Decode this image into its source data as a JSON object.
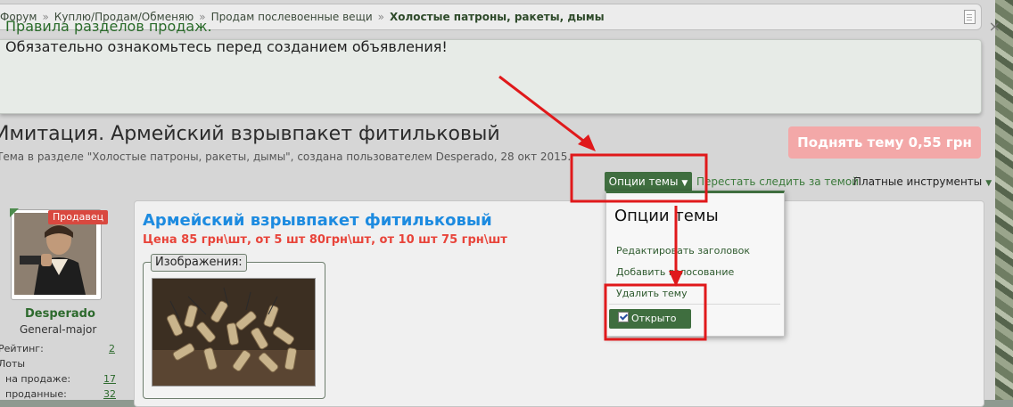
{
  "breadcrumb": {
    "items": [
      "Форум",
      "Куплю/Продам/Обменяю",
      "Продам послевоенные вещи"
    ],
    "current": "Холостые патроны, ракеты, дымы",
    "separator": "»"
  },
  "notice": {
    "title": "Правила разделов продаж.",
    "text": "Обязательно ознакомьтесь перед созданием объявления!",
    "close": "×"
  },
  "thread": {
    "title": "Имитация. Армейский взрывпакет фитильковый",
    "meta": "Тема в разделе \"Холостые патроны, ракеты, дымы\", создана пользователем Desperado, 28 окт 2015.",
    "bump_button": "Поднять тему 0,55 грн"
  },
  "toolbar": {
    "options_label": "Опции темы",
    "unwatch_label": "Перестать следить за темой",
    "paid_tools_label": "Платные инструменты"
  },
  "menu": {
    "title": "Опции темы",
    "items": [
      "Редактировать заголовок",
      "Добавить голосование",
      "Удалить тему"
    ],
    "open_label": "Открыто",
    "open_checked": true
  },
  "post": {
    "title": "Армейский взрывпакет фитильковый",
    "price": "Цена 85 грн\\шт, от 5 шт 80грн\\шт, от 10 шт 75 грн\\шт",
    "images_label": "Изображения:"
  },
  "author": {
    "badge": "Продавец",
    "name": "Desperado",
    "title": "General-major",
    "rating_label": "Рейтинг:",
    "rating": "2",
    "lots_label": "Лоты",
    "on_sale_label": "на продаже:",
    "on_sale": "17",
    "sold_label": "проданные:",
    "sold": "32"
  },
  "colors": {
    "accent": "#3f6e3f",
    "link_blue": "#1d8be0",
    "price_red": "#e8443a",
    "annotation_red": "#e0191b"
  },
  "icons": [
    "close-icon",
    "chevron-down-icon",
    "checkbox-icon",
    "document-icon"
  ]
}
